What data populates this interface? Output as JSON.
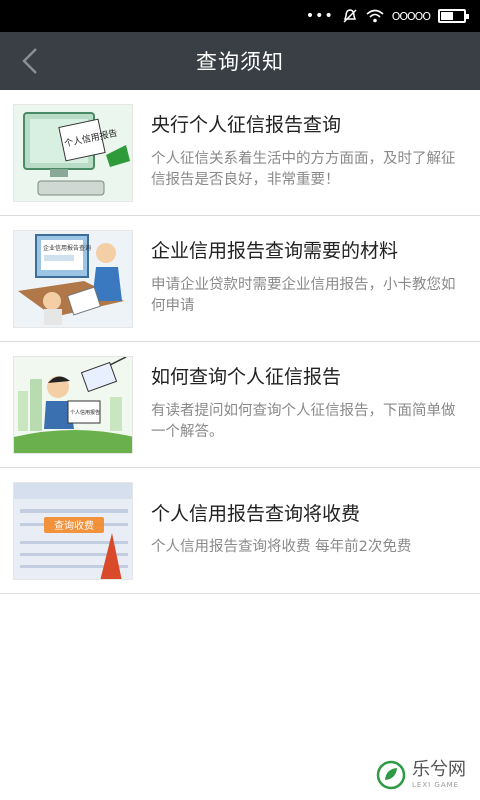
{
  "status_bar": {
    "dots": "•••",
    "signal": "OOOOO"
  },
  "header": {
    "title": "查询须知"
  },
  "items": [
    {
      "title": "央行个人征信报告查询",
      "desc": "个人征信关系着生活中的方方面面，及时了解征信报告是否良好，非常重要！",
      "thumb_label": "个人信用报告"
    },
    {
      "title": "企业信用报告查询需要的材料",
      "desc": "申请企业贷款时需要企业信用报告，小卡教您如何申请",
      "thumb_label": "企业信用报告查询"
    },
    {
      "title": "如何查询个人征信报告",
      "desc": "有读者提问如何查询个人征信报告，下面简单做一个解答。",
      "thumb_label": "个人信用报告"
    },
    {
      "title": "个人信用报告查询将收费",
      "desc": "个人信用报告查询将收费 每年前2次免费",
      "thumb_label": "查询收费"
    }
  ],
  "watermark": {
    "main": "乐兮网",
    "sub": "LEXI GAME"
  },
  "colors": {
    "title_bar": "#3a3f45",
    "item_title": "#222222",
    "item_desc": "#8a8a8a",
    "divider": "#dcdcdc"
  }
}
